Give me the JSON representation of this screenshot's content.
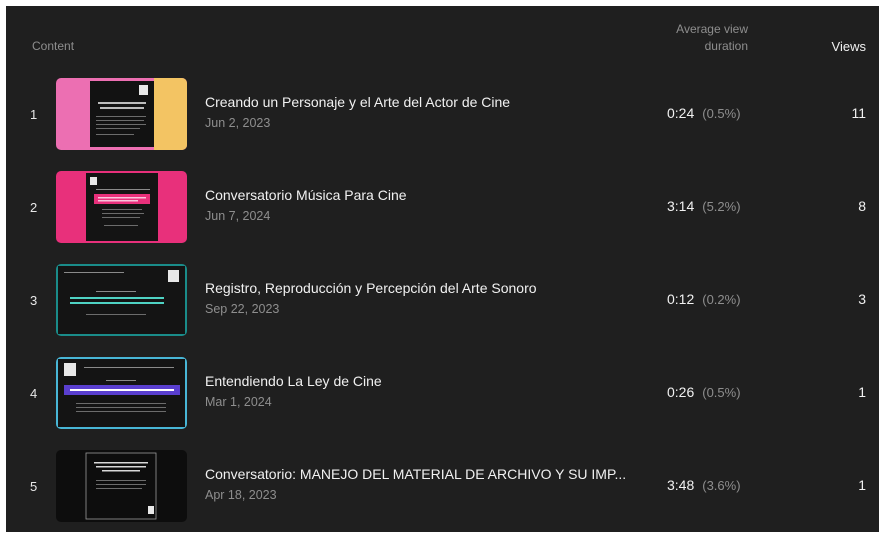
{
  "header": {
    "content_label": "Content",
    "avg_view_line1": "Average view",
    "avg_view_line2": "duration",
    "views_label": "Views"
  },
  "rows": [
    {
      "rank": "1",
      "title": "Creando un Personaje y el Arte del Actor de Cine",
      "date": "Jun 2, 2023",
      "duration": "0:24",
      "percent": "(0.5%)",
      "views": "11",
      "thumb_theme": "pink-yellow"
    },
    {
      "rank": "2",
      "title": "Conversatorio Música Para Cine",
      "date": "Jun 7, 2024",
      "duration": "3:14",
      "percent": "(5.2%)",
      "views": "8",
      "thumb_theme": "magenta"
    },
    {
      "rank": "3",
      "title": "Registro, Reproducción y Percepción del Arte Sonoro",
      "date": "Sep 22, 2023",
      "duration": "0:12",
      "percent": "(0.2%)",
      "views": "3",
      "thumb_theme": "teal-dark"
    },
    {
      "rank": "4",
      "title": "Entendiendo La Ley de Cine",
      "date": "Mar 1, 2024",
      "duration": "0:26",
      "percent": "(0.5%)",
      "views": "1",
      "thumb_theme": "blue-dark"
    },
    {
      "rank": "5",
      "title": "Conversatorio: MANEJO DEL MATERIAL DE ARCHIVO Y SU IMP...",
      "date": "Apr 18, 2023",
      "duration": "3:48",
      "percent": "(3.6%)",
      "views": "1",
      "thumb_theme": "black"
    }
  ]
}
